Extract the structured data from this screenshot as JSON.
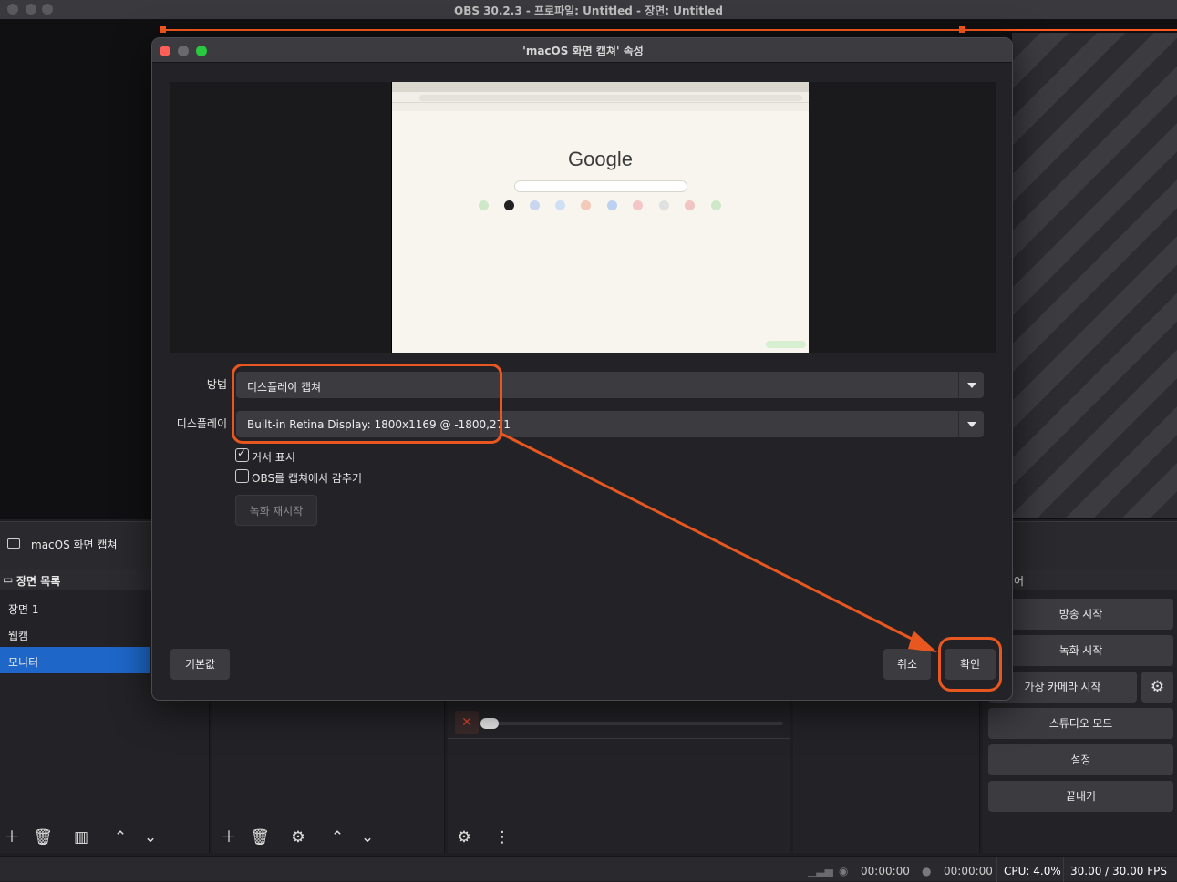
{
  "app": {
    "window_title": "OBS 30.2.3 - 프로파일: Untitled - 장면: Untitled"
  },
  "source_strip": {
    "source_name": "macOS 화면 캡쳐"
  },
  "scenes": {
    "header": "장면 목록",
    "items": [
      {
        "label": "장면 1",
        "active": false
      },
      {
        "label": "웹캠",
        "active": false
      },
      {
        "label": "모니터",
        "active": true
      }
    ]
  },
  "controls": {
    "header_partial": "어",
    "start_streaming": "방송 시작",
    "start_recording": "녹화 시작",
    "start_virtual_camera": "가상 카메라 시작",
    "studio_mode": "스튜디오 모드",
    "settings": "설정",
    "exit": "끝내기"
  },
  "statusbar": {
    "stream_time": "00:00:00",
    "record_time": "00:00:00",
    "cpu": "CPU: 4.0%",
    "fps": "30.00 / 30.00 FPS"
  },
  "dialog": {
    "title": "'macOS 화면 캡쳐' 속성",
    "preview": {
      "google_logo": "Google"
    },
    "method_label": "방법",
    "method_value": "디스플레이 캡쳐",
    "display_label": "디스플레이",
    "display_value": "Built-in Retina Display: 1800x1169 @ -1800,271",
    "show_cursor_label": "커서 표시",
    "show_cursor_checked": true,
    "hide_obs_label": "OBS를 캡쳐에서 감추기",
    "hide_obs_checked": false,
    "restart_recording_button": "녹화 재시작",
    "defaults_button": "기본값",
    "cancel_button": "취소",
    "ok_button": "확인"
  },
  "colors": {
    "accent_selection": "#1e67c8",
    "annotation": "#e8571f",
    "red_line": "#ff5a1e"
  }
}
